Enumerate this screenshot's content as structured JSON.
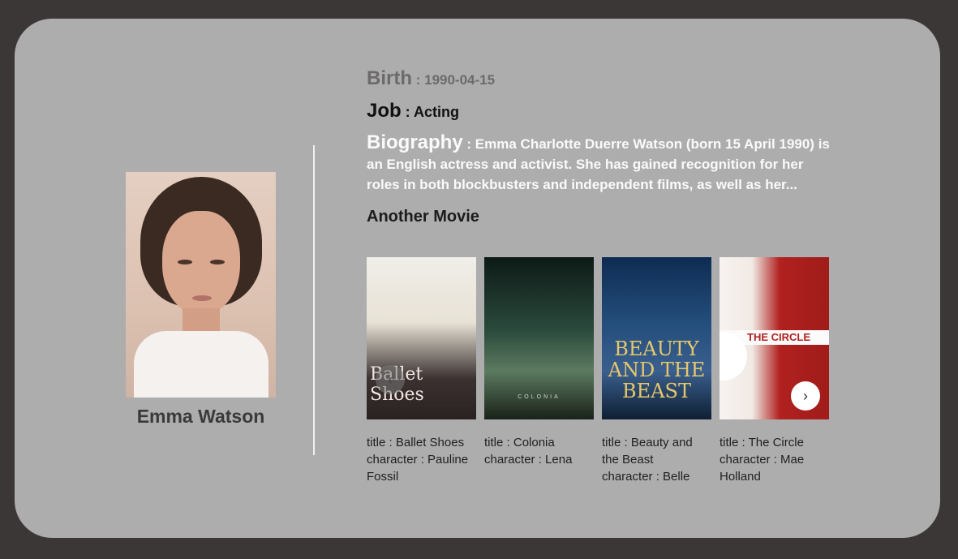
{
  "person": {
    "name": "Emma Watson",
    "birth_label": "Birth",
    "birth_value": "1990-04-15",
    "job_label": "Job",
    "job_value": "Acting",
    "bio_label": "Biography",
    "bio_value": "Emma Charlotte Duerre Watson (born 15 April 1990) is an English actress and activist. She has gained recognition for her roles in both blockbusters and independent films, as well as her..."
  },
  "another_movie_heading": "Another Movie",
  "separator": " : ",
  "movies": [
    {
      "poster_text": "Ballet Shoes",
      "title_label": "title",
      "title": "Ballet Shoes",
      "character_label": "character",
      "character": "Pauline Fossil"
    },
    {
      "poster_text": "COLONIA",
      "title_label": "title",
      "title": "Colonia",
      "character_label": "character",
      "character": "Lena"
    },
    {
      "poster_text": "BEAUTY AND THE BEAST",
      "title_label": "title",
      "title": "Beauty and the Beast",
      "character_label": "character",
      "character": "Belle"
    },
    {
      "poster_text": "THE CIRCLE",
      "title_label": "title",
      "title": "The Circle",
      "character_label": "character",
      "character": "Mae Holland"
    }
  ],
  "carousel": {
    "prev_icon": "chevron-left-icon",
    "next_icon": "chevron-right-icon",
    "prev_glyph": "‹",
    "next_glyph": "›"
  },
  "colors": {
    "background": "#3b3736",
    "card": "#adadad",
    "birth": "#6d6a6a",
    "bio": "#fafafa"
  }
}
